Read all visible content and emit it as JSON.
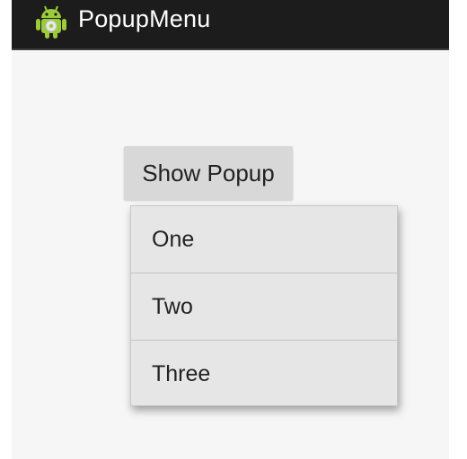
{
  "action_bar": {
    "title": "PopupMenu",
    "icon": "android-robot-icon",
    "background": "#1c1c1c"
  },
  "main": {
    "show_popup_label": "Show Popup"
  },
  "popup_menu": {
    "items": [
      {
        "label": "One"
      },
      {
        "label": "Two"
      },
      {
        "label": "Three"
      }
    ]
  }
}
